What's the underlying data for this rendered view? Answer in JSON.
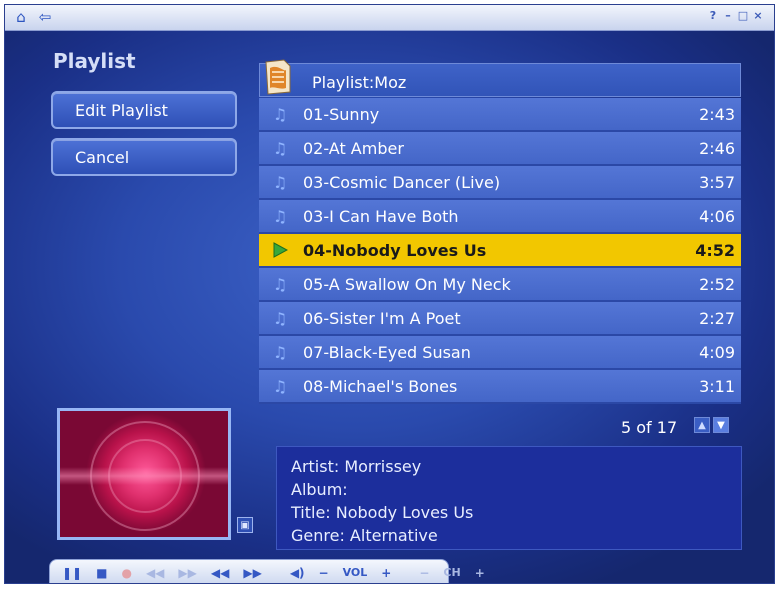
{
  "window": {
    "nav": {
      "home_icon": "home-icon",
      "back_icon": "back-arrow-icon"
    },
    "controls": [
      "?",
      "–",
      "□",
      "×"
    ]
  },
  "sidebar": {
    "title": "Playlist",
    "buttons": [
      {
        "label": "Edit Playlist"
      },
      {
        "label": "Cancel"
      }
    ]
  },
  "playlist": {
    "header": "Playlist:Moz",
    "tracks": [
      {
        "name": "01-Sunny",
        "duration": "2:43"
      },
      {
        "name": "02-At Amber",
        "duration": "2:46"
      },
      {
        "name": "03-Cosmic Dancer (Live)",
        "duration": "3:57"
      },
      {
        "name": "03-I Can Have Both",
        "duration": "4:06"
      },
      {
        "name": "04-Nobody Loves Us",
        "duration": "4:52",
        "playing": true
      },
      {
        "name": "05-A Swallow On My Neck",
        "duration": "2:52"
      },
      {
        "name": "06-Sister I'm A Poet",
        "duration": "2:27"
      },
      {
        "name": "07-Black-Eyed Susan",
        "duration": "4:09"
      },
      {
        "name": "08-Michael's Bones",
        "duration": "3:11"
      }
    ],
    "pager": "5 of 17"
  },
  "info": {
    "artist": "Artist: Morrissey",
    "album": "Album:",
    "title": "Title: Nobody Loves Us",
    "genre": "Genre: Alternative"
  },
  "transport": {
    "vol_label": "VOL",
    "ch_label": "CH"
  },
  "colors": {
    "background": "#2a4aad",
    "row": "#4466c8",
    "highlight": "#f2c700",
    "info_panel": "#1c2e9c"
  }
}
